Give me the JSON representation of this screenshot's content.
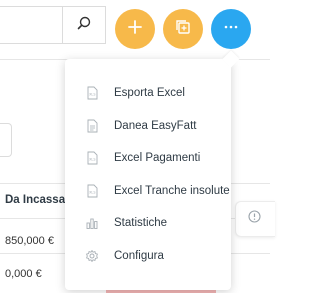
{
  "header": {
    "search": {
      "value": "",
      "placeholder": ""
    },
    "search_icon": "search-icon",
    "buttons": [
      {
        "name": "add",
        "icon": "plus-icon",
        "color": "#f7b94a"
      },
      {
        "name": "duplicate",
        "icon": "copy-icon",
        "color": "#f7b94a"
      },
      {
        "name": "more",
        "icon": "ellipsis-icon",
        "color": "#2aa7f0"
      }
    ]
  },
  "table": {
    "column_header": "Da Incassare",
    "rows": [
      "850,000 €",
      "0,000 €"
    ]
  },
  "menu": {
    "items": [
      {
        "label": "Esporta Excel",
        "icon": "excel-file-icon"
      },
      {
        "label": "Danea EasyFatt",
        "icon": "document-icon"
      },
      {
        "label": "Excel Pagamenti",
        "icon": "excel-file-icon"
      },
      {
        "label": "Excel Tranche insolute",
        "icon": "excel-file-icon"
      },
      {
        "label": "Statistiche",
        "icon": "bar-chart-icon"
      },
      {
        "label": "Configura",
        "icon": "gear-icon"
      }
    ]
  },
  "side_widget": {
    "icon": "info-icon"
  },
  "colors": {
    "accent_orange": "#f7b94a",
    "accent_blue": "#2aa7f0",
    "text_dark": "#2f3b45",
    "icon_gray": "#a9b0b6"
  }
}
